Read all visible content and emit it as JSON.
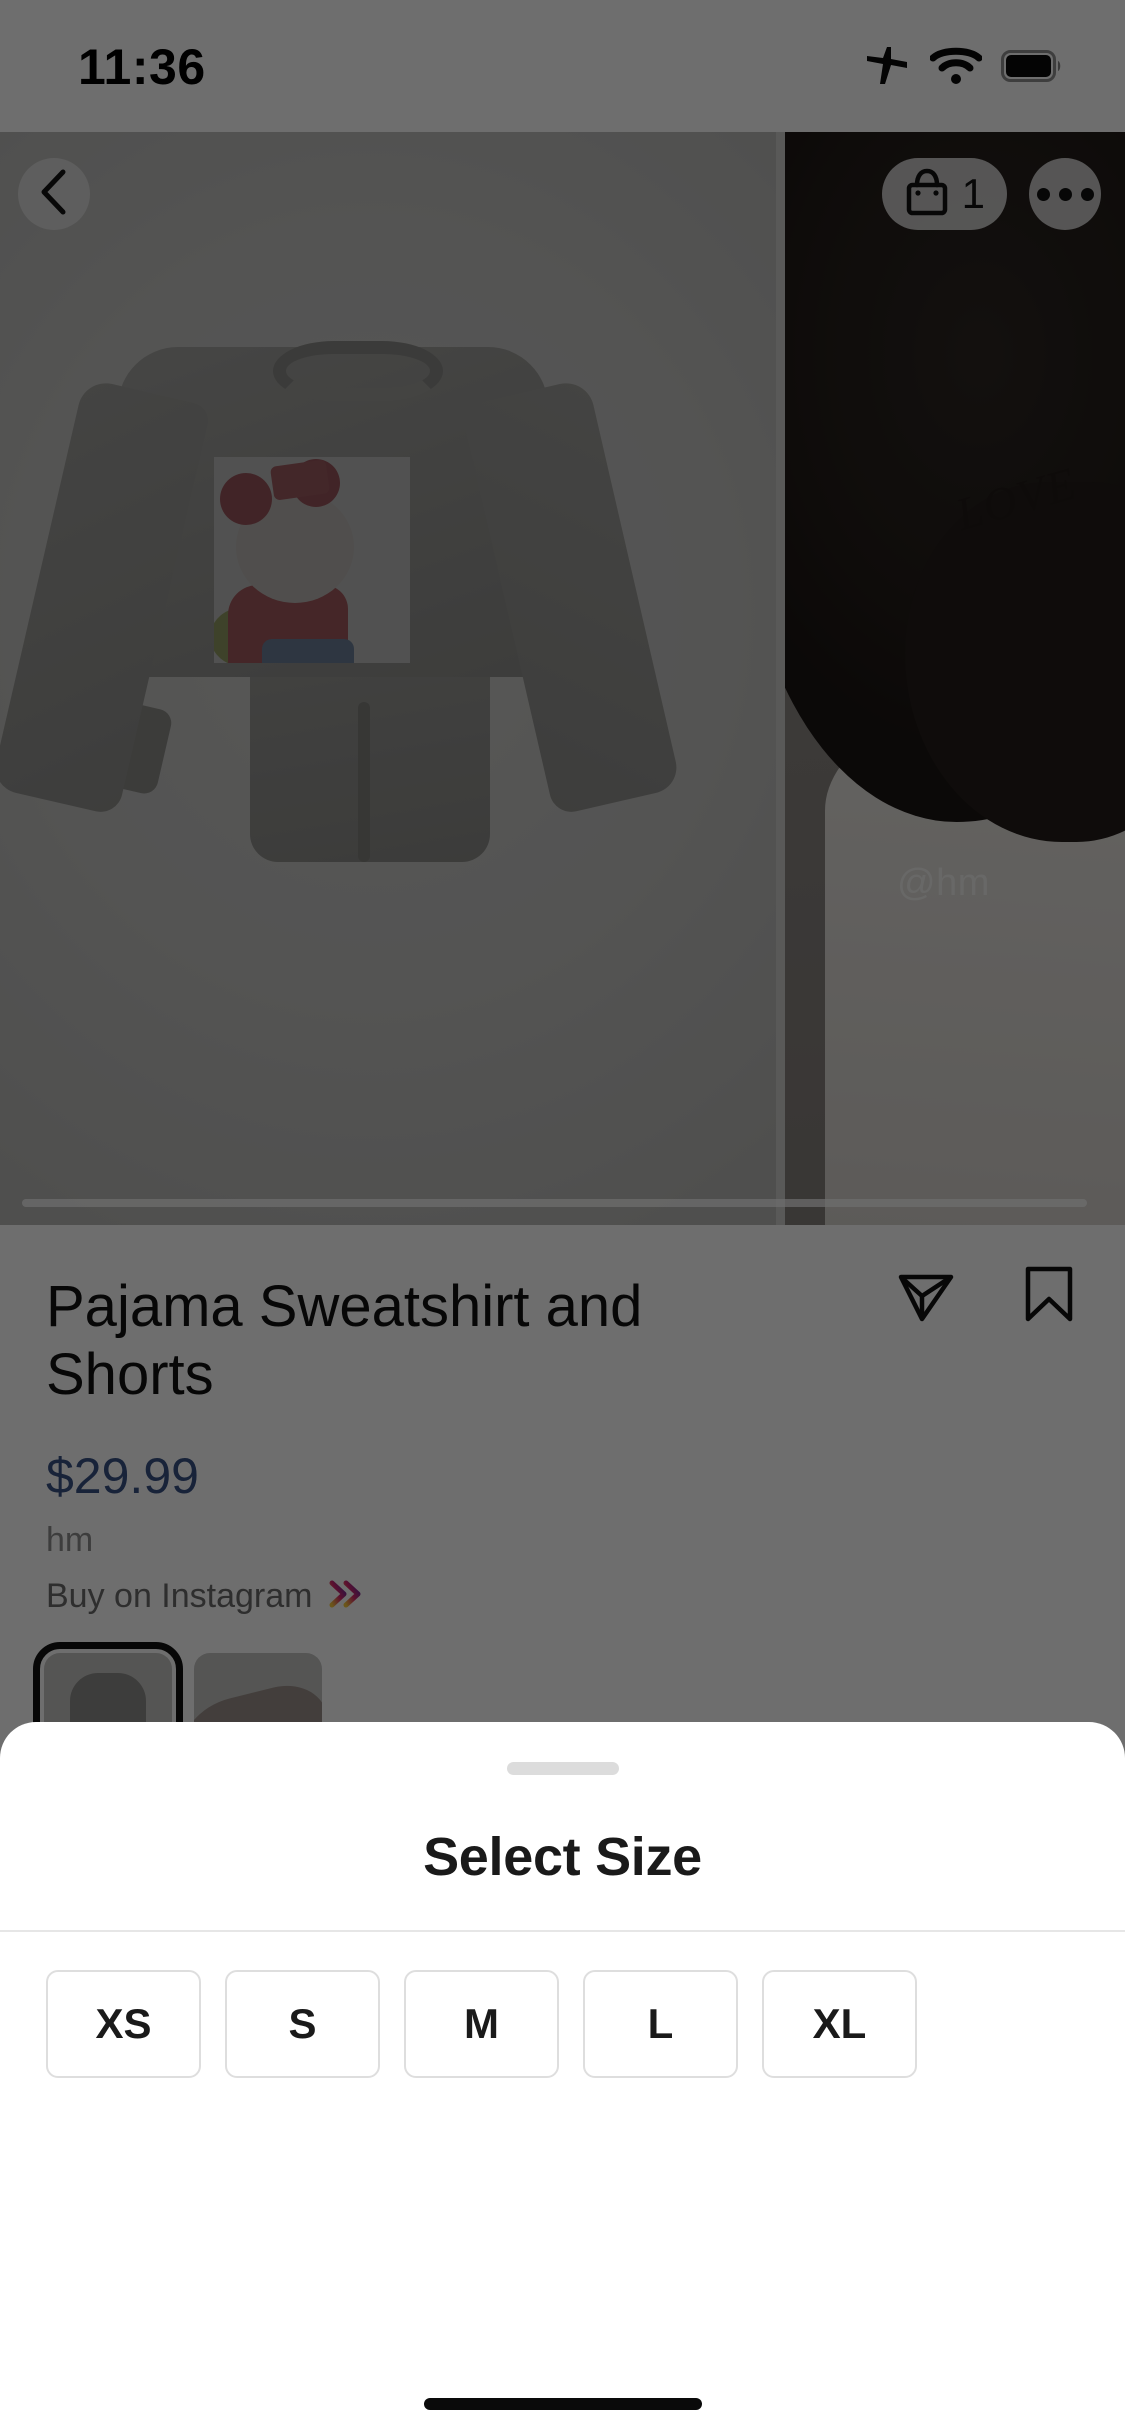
{
  "status_bar": {
    "time": "11:36",
    "icons": [
      "airplane-mode-icon",
      "wifi-icon",
      "battery-icon"
    ]
  },
  "carousel": {
    "back_icon": "chevron-left-icon",
    "bag_icon": "shopping-bag-icon",
    "bag_count": "1",
    "more_icon": "ellipsis-icon",
    "slides": [
      {
        "name": "product-flatlay",
        "watermark": ""
      },
      {
        "name": "lifestyle-model",
        "watermark": "@hm",
        "tattoo_text": "LOVE"
      }
    ],
    "current_index": 1,
    "total": 2
  },
  "product": {
    "title": "Pajama Sweatshirt and Shorts",
    "price": "$29.99",
    "price_color": "#385185",
    "brand": "hm",
    "buy_label": "Buy on Instagram",
    "buy_chevron_icon": "double-chevron-right-icon",
    "share_icon": "paper-plane-icon",
    "save_icon": "bookmark-icon",
    "thumbnails": [
      {
        "name": "thumbnail-product",
        "selected": true
      },
      {
        "name": "thumbnail-lifestyle",
        "selected": false
      }
    ]
  },
  "size_sheet": {
    "grabber": "drag-handle",
    "title": "Select Size",
    "options": [
      {
        "label": "XS",
        "selected": false
      },
      {
        "label": "S",
        "selected": false
      },
      {
        "label": "M",
        "selected": false
      },
      {
        "label": "L",
        "selected": false
      },
      {
        "label": "XL",
        "selected": false
      }
    ]
  },
  "system": {
    "home_indicator": "home-indicator"
  }
}
